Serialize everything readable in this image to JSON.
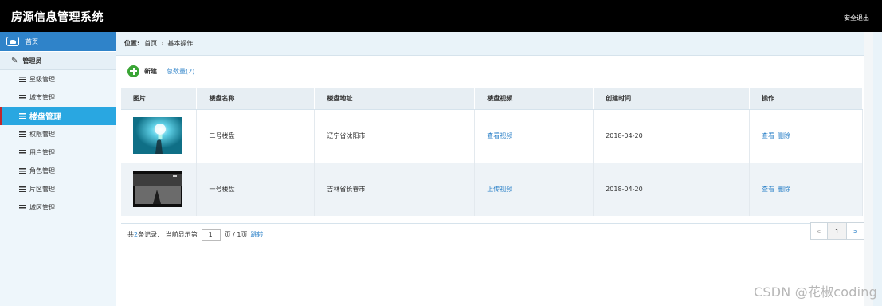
{
  "header": {
    "app_title": "房源信息管理系统",
    "logout": "安全退出"
  },
  "sidebar": {
    "home": "首页",
    "group": "管理员",
    "items": [
      {
        "label": "星级管理",
        "active": false
      },
      {
        "label": "城市管理",
        "active": false
      },
      {
        "label": "楼盘管理",
        "active": true
      },
      {
        "label": "权限管理",
        "active": false
      },
      {
        "label": "用户管理",
        "active": false
      },
      {
        "label": "角色管理",
        "active": false
      },
      {
        "label": "片区管理",
        "active": false
      },
      {
        "label": "城区管理",
        "active": false
      }
    ]
  },
  "breadcrumb": {
    "position_label": "位置:",
    "home": "首页",
    "separator": "›",
    "current": "基本操作"
  },
  "toolbar": {
    "add_label": "新建",
    "total_label": "总数量(2)"
  },
  "table": {
    "columns": [
      "图片",
      "楼盘名称",
      "楼盘地址",
      "楼盘视频",
      "创建时间",
      "操作"
    ],
    "rows": [
      {
        "name": "二号楼盘",
        "address": "辽宁省沈阳市",
        "video": "查看视频",
        "created": "2018-04-20",
        "view": "查看",
        "delete": "删除"
      },
      {
        "name": "一号楼盘",
        "address": "吉林省长春市",
        "video": "上传视频",
        "created": "2018-04-20",
        "view": "查看",
        "delete": "删除"
      }
    ]
  },
  "footer": {
    "total_prefix": "共",
    "total_count": "2",
    "total_suffix": "条记录,",
    "current_prefix": "当前显示第",
    "page_value": "1",
    "page_suffix": "页 / 1页",
    "jump": "跳转"
  },
  "pager": {
    "prev": "<",
    "current": "1",
    "next": ">"
  },
  "watermark": "CSDN @花椒coding",
  "colors": {
    "topbar": "#000000",
    "sidebar_active": "#29a7e1",
    "home_bg": "#2f83c9",
    "link": "#2f83c9",
    "add_icon": "#3aa535"
  }
}
